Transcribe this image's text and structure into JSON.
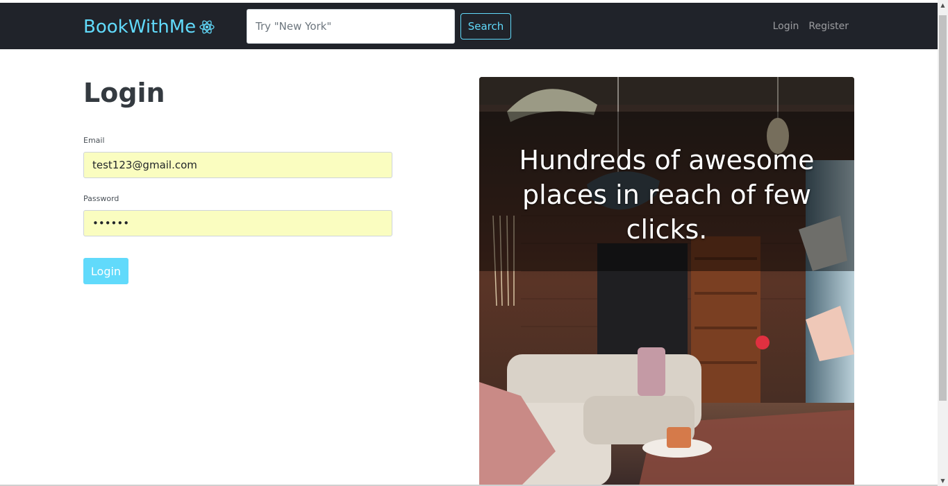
{
  "navbar": {
    "brand": "BookWithMe",
    "brand_icon": "react-atom-icon",
    "search_placeholder": "Try \"New York\"",
    "search_button": "Search",
    "links": [
      "Login",
      "Register"
    ]
  },
  "login_form": {
    "title": "Login",
    "email_label": "Email",
    "email_value": "test123@gmail.com",
    "password_label": "Password",
    "password_value": "••••••",
    "submit_label": "Login"
  },
  "hero": {
    "caption": "Hundreds of awesome places in reach of few clicks."
  },
  "colors": {
    "accent": "#61dafb",
    "navbar_bg": "#20232a",
    "autofill_bg": "#fafdc0",
    "title_text": "#343a40"
  }
}
